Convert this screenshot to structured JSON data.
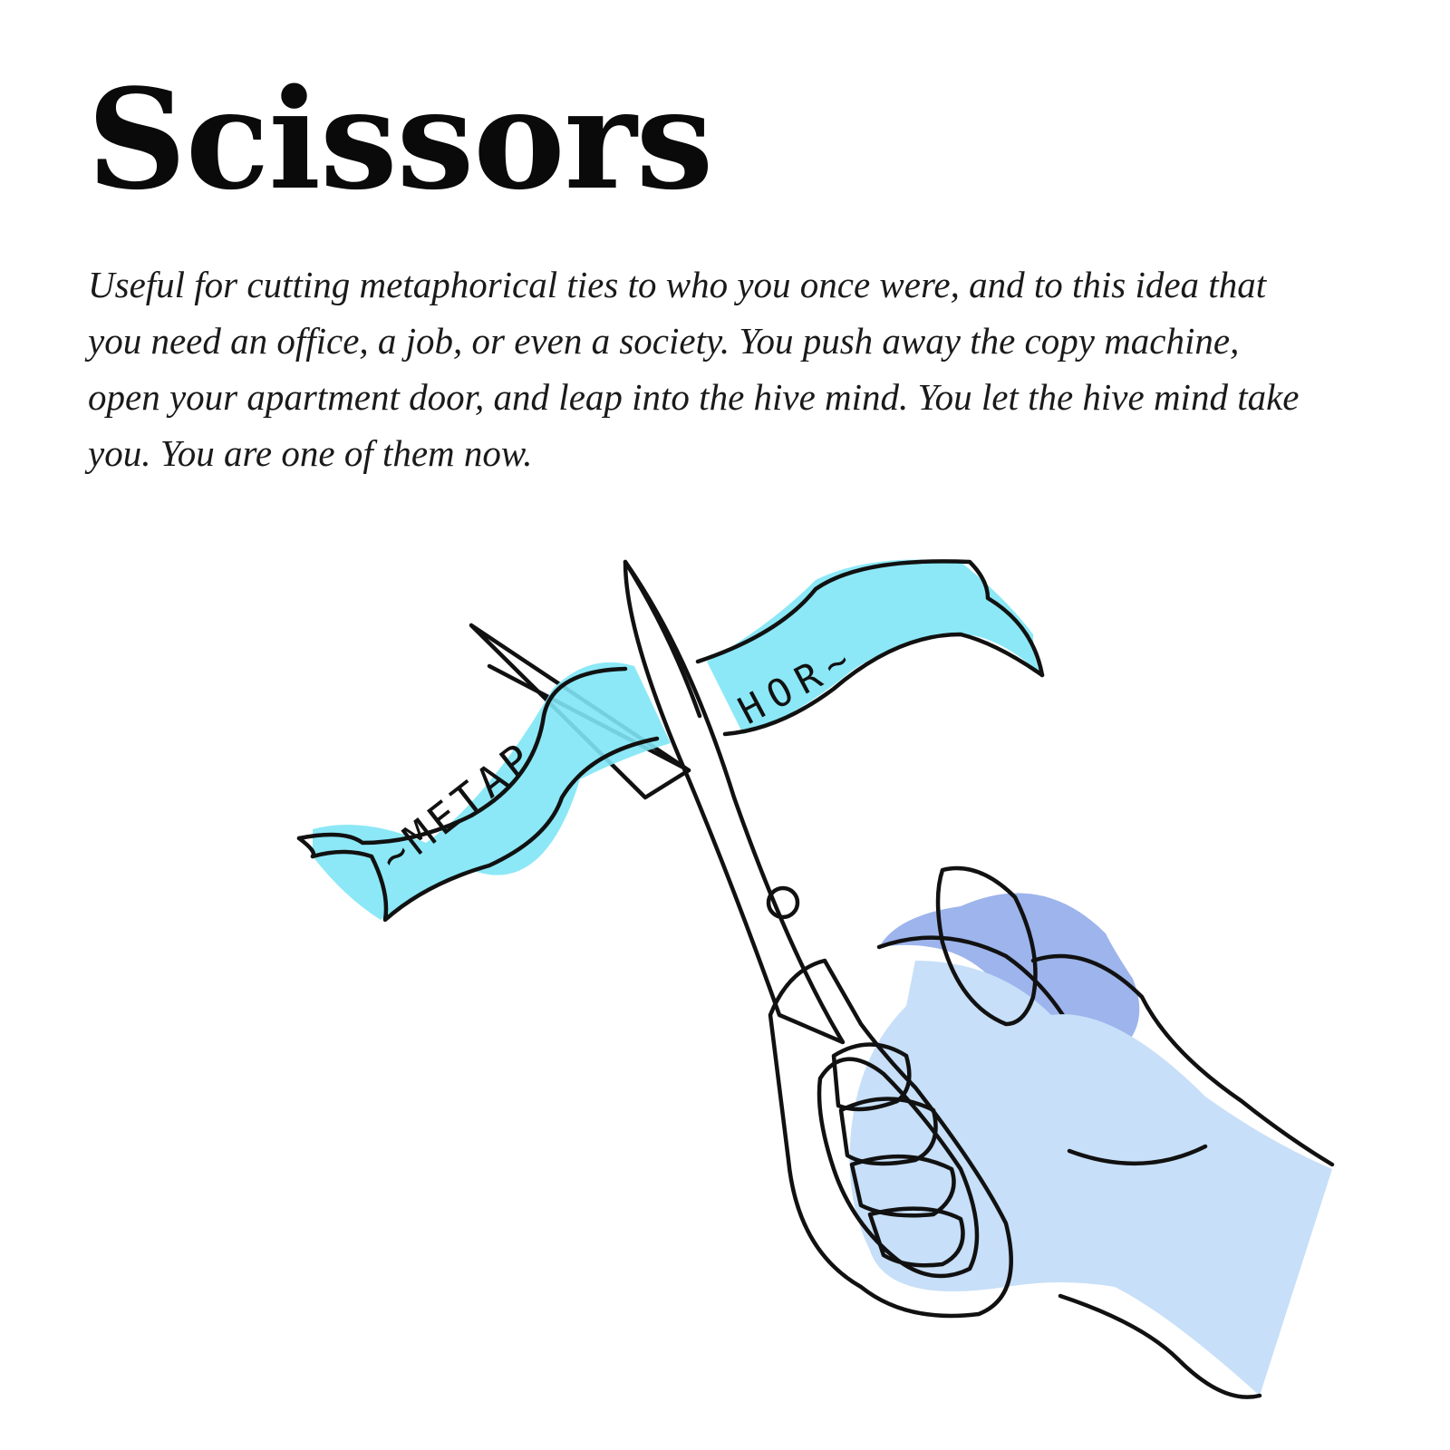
{
  "title": "Scissors",
  "description": "Useful for cutting metaphorical ties to who you once were, and to this idea that you need an office, a job, or even a society. You push away the copy machine, open your apartment door, and leap into the hive mind. You let the hive mind take you. You are one of them now.",
  "illustration": {
    "ribbon_left_text": "~METAP",
    "ribbon_right_text": "HOR~",
    "colors": {
      "ribbon": "#7fe6f5",
      "handle": "#9db4ec",
      "hand": "#c7dff8",
      "ink": "#111111",
      "blade": "#ffffff"
    }
  }
}
